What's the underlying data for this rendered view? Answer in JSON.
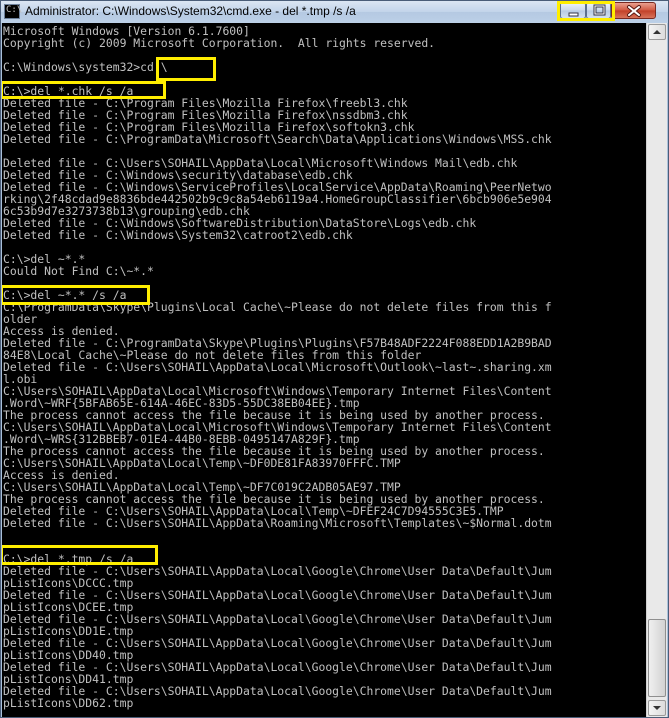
{
  "window": {
    "title": "Administrator: C:\\Windows\\System32\\cmd.exe - del  *.tmp /s /a",
    "icon_text": "C:\\"
  },
  "icons": {
    "app": "cmd-console-icon",
    "minimize": "minimize-icon",
    "maximize": "maximize-icon",
    "close": "close-icon",
    "scroll_up": "scroll-up-arrow-icon",
    "scroll_down": "scroll-down-arrow-icon"
  },
  "colors": {
    "console_bg": "#000000",
    "console_text": "#c0c0c0",
    "highlight": "#ffee00",
    "close_button": "#c7442b"
  },
  "console": {
    "lines": [
      "Microsoft Windows [Version 6.1.7600]",
      "Copyright (c) 2009 Microsoft Corporation.  All rights reserved.",
      "",
      "C:\\Windows\\system32>cd \\",
      "",
      "C:\\>del *.chk /s /a",
      "Deleted file - C:\\Program Files\\Mozilla Firefox\\freebl3.chk",
      "Deleted file - C:\\Program Files\\Mozilla Firefox\\nssdbm3.chk",
      "Deleted file - C:\\Program Files\\Mozilla Firefox\\softokn3.chk",
      "Deleted file - C:\\ProgramData\\Microsoft\\Search\\Data\\Applications\\Windows\\MSS.chk",
      "",
      "Deleted file - C:\\Users\\SOHAIL\\AppData\\Local\\Microsoft\\Windows Mail\\edb.chk",
      "Deleted file - C:\\Windows\\security\\database\\edb.chk",
      "Deleted file - C:\\Windows\\ServiceProfiles\\LocalService\\AppData\\Roaming\\PeerNetwo",
      "rking\\2f48cdad9e8836bde442502b9c9c8a54eb6119a4.HomeGroupClassifier\\6bcb906e5e904",
      "6c53b9d7e3273738b13\\grouping\\edb.chk",
      "Deleted file - C:\\Windows\\SoftwareDistribution\\DataStore\\Logs\\edb.chk",
      "Deleted file - C:\\Windows\\System32\\catroot2\\edb.chk",
      "",
      "C:\\>del ~*.*",
      "Could Not Find C:\\~*.*",
      "",
      "C:\\>del ~*.* /s /a",
      "C:\\ProgramData\\Skype\\Plugins\\Local Cache\\~Please do not delete files from this f",
      "older",
      "Access is denied.",
      "Deleted file - C:\\ProgramData\\Skype\\Plugins\\Plugins\\F57B48ADF2224F088EDD1A2B9BAD",
      "84E8\\Local Cache\\~Please do not delete files from this folder",
      "Deleted file - C:\\Users\\SOHAIL\\AppData\\Local\\Microsoft\\Outlook\\~last~.sharing.xm",
      "l.obi",
      "C:\\Users\\SOHAIL\\AppData\\Local\\Microsoft\\Windows\\Temporary Internet Files\\Content",
      ".Word\\~WRF{5BFAB65E-614A-46EC-83D5-55DC38EB04EE}.tmp",
      "The process cannot access the file because it is being used by another process.",
      "C:\\Users\\SOHAIL\\AppData\\Local\\Microsoft\\Windows\\Temporary Internet Files\\Content",
      ".Word\\~WRS{312BBEB7-01E4-44B0-8EBB-0495147A829F}.tmp",
      "The process cannot access the file because it is being used by another process.",
      "C:\\Users\\SOHAIL\\AppData\\Local\\Temp\\~DF0DE81FA83970FFFC.TMP",
      "Access is denied.",
      "C:\\Users\\SOHAIL\\AppData\\Local\\Temp\\~DF7C019C2ADB05AE97.TMP",
      "The process cannot access the file because it is being used by another process.",
      "Deleted file - C:\\Users\\SOHAIL\\AppData\\Local\\Temp\\~DFEF24C7D94555C3E5.TMP",
      "Deleted file - C:\\Users\\SOHAIL\\AppData\\Roaming\\Microsoft\\Templates\\~$Normal.dotm",
      "",
      "",
      "C:\\>del *.tmp /s /a",
      "Deleted file - C:\\Users\\SOHAIL\\AppData\\Local\\Google\\Chrome\\User Data\\Default\\Jum",
      "pListIcons\\DCCC.tmp",
      "Deleted file - C:\\Users\\SOHAIL\\AppData\\Local\\Google\\Chrome\\User Data\\Default\\Jum",
      "pListIcons\\DCEE.tmp",
      "Deleted file - C:\\Users\\SOHAIL\\AppData\\Local\\Google\\Chrome\\User Data\\Default\\Jum",
      "pListIcons\\DD1E.tmp",
      "Deleted file - C:\\Users\\SOHAIL\\AppData\\Local\\Google\\Chrome\\User Data\\Default\\Jum",
      "pListIcons\\DD40.tmp",
      "Deleted file - C:\\Users\\SOHAIL\\AppData\\Local\\Google\\Chrome\\User Data\\Default\\Jum",
      "pListIcons\\DD41.tmp",
      "Deleted file - C:\\Users\\SOHAIL\\AppData\\Local\\Google\\Chrome\\User Data\\Default\\Jum",
      "pListIcons\\DD62.tmp"
    ]
  }
}
